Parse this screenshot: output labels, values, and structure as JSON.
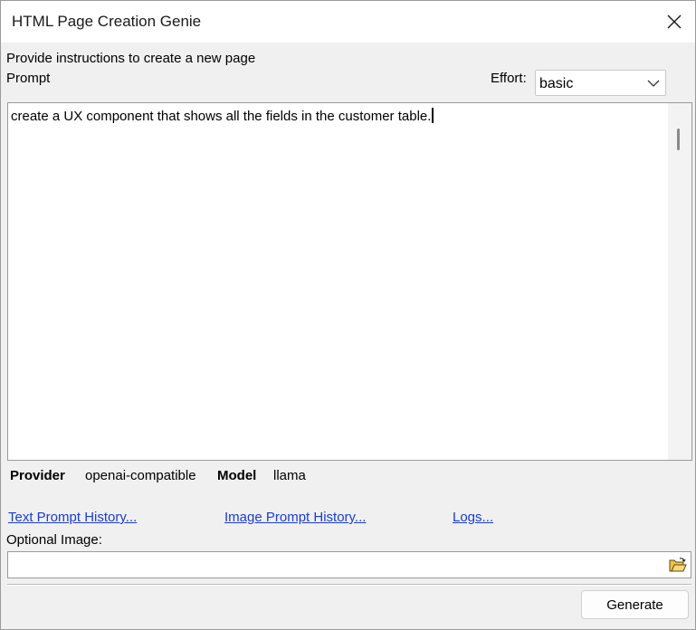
{
  "window": {
    "title": "HTML Page Creation Genie"
  },
  "instructions": "Provide instructions to create a new page",
  "prompt_label": "Prompt",
  "effort": {
    "label": "Effort:",
    "value": "basic"
  },
  "prompt_text": "create a UX component that shows all the fields in the customer table.",
  "provider": {
    "label": "Provider",
    "value": "openai-compatible"
  },
  "model": {
    "label": "Model",
    "value": "llama"
  },
  "links": {
    "text_history": "Text Prompt History...",
    "image_history": "Image Prompt History...",
    "logs": "Logs..."
  },
  "optional_image": {
    "label": "Optional Image:",
    "value": ""
  },
  "generate_label": "Generate",
  "icons": {
    "close": "close-icon",
    "dropdown": "chevron-down-icon",
    "folder": "open-folder-icon"
  },
  "colors": {
    "link": "#1a3cd6",
    "dialog_bg": "#f0f0f0",
    "folder_icon": "#e8b33a"
  }
}
